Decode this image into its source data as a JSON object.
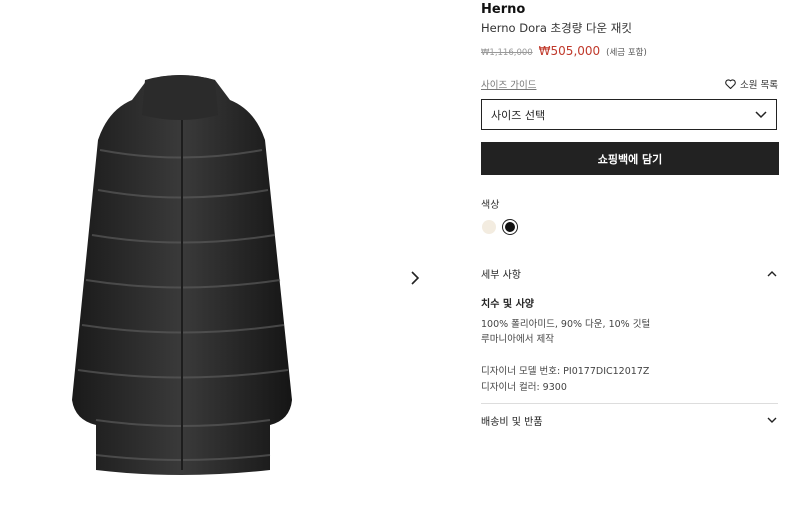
{
  "product": {
    "brand": "Herno",
    "title": "Herno Dora 초경량 다운 재킷",
    "price_old": "₩1,116,000",
    "price_new": "₩505,000",
    "price_note": "(세금 포함)"
  },
  "actions": {
    "size_guide": "사이즈 가이드",
    "wishlist": "소원 목록",
    "size_select": "사이즈 선택",
    "add_to_bag": "쇼핑백에 담기"
  },
  "colors": {
    "label": "색상",
    "swatches": [
      "#f3ece0",
      "#111111"
    ],
    "selected": "#111111"
  },
  "details": {
    "heading": "세부 사항",
    "subheading": "치수 및 사양",
    "lines": [
      "100% 폴리아미드, 90% 다운, 10% 깃털",
      "루마니아에서 제작",
      "디자이너 모델 번호: PI0177DIC12017Z",
      "디자이너 컬러: 9300"
    ]
  },
  "shipping": {
    "heading": "배송비 및 반품"
  },
  "icons": {
    "next": "chevron-right-icon",
    "wishlist": "heart-icon",
    "select": "chevron-down-icon",
    "details_toggle": "chevron-up-icon",
    "shipping_toggle": "chevron-down-icon"
  }
}
